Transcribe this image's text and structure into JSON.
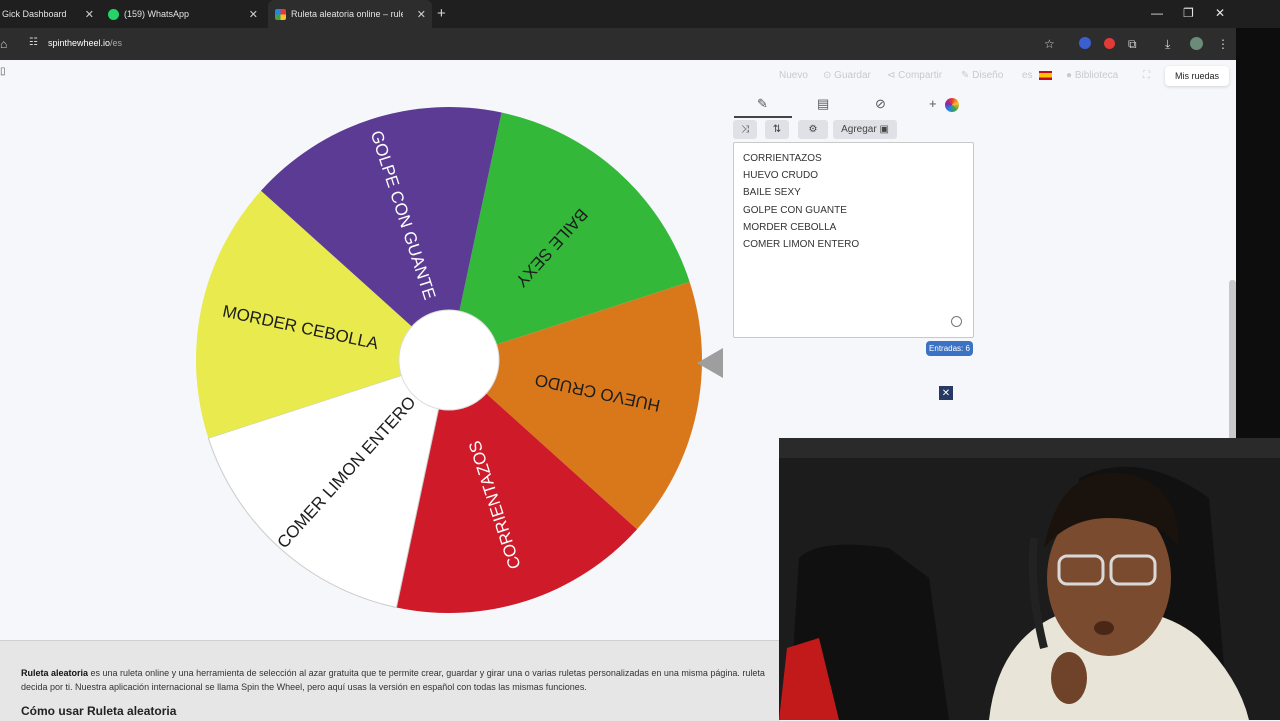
{
  "browser": {
    "tabs": [
      {
        "title": "Gick Dashboard",
        "active": false
      },
      {
        "title": "(159) WhatsApp",
        "active": false
      },
      {
        "title": "Ruleta aleatoria online – ruleta",
        "active": true
      }
    ],
    "url_host": "spinthewheel.io",
    "url_path": "/es"
  },
  "topnav": {
    "nuevo": "Nuevo",
    "guardar": "Guardar",
    "compartir": "Compartir",
    "disenio": "Diseño",
    "lang": "es",
    "biblioteca": "Biblioteca",
    "mis_ruedas": "Mis ruedas"
  },
  "editor": {
    "add_button": "Agregar",
    "entries": [
      "CORRIENTAZOS",
      "HUEVO CRUDO",
      "BAILE SEXY",
      "GOLPE CON GUANTE",
      "MORDER CEBOLLA",
      "COMER LIMON ENTERO"
    ],
    "entry_count_label": "Entradas: 6"
  },
  "wheel": {
    "segments": [
      {
        "label": "BAILE SEXY",
        "color": "#33b83a"
      },
      {
        "label": "HUEVO CRUDO",
        "color": "#d9781b"
      },
      {
        "label": "CORRIENTAZOS",
        "color": "#cf1a2a"
      },
      {
        "label": "COMER LIMON ENTERO",
        "color": "#ffffff"
      },
      {
        "label": "MORDER CEBOLLA",
        "color": "#e8ea4e"
      },
      {
        "label": "GOLPE CON GUANTE",
        "color": "#5c3b94"
      }
    ]
  },
  "info": {
    "bold": "Ruleta aleatoria",
    "text": " es una ruleta online y una herramienta de selección al azar gratuita que te permite crear, guardar y girar una o varias ruletas personalizadas en una misma página. ruleta decida por ti. Nuestra aplicación internacional se llama Spin the Wheel, pero aquí usas la versión en español con todas las mismas funciones.",
    "heading": "Cómo usar Ruleta aleatoria"
  }
}
